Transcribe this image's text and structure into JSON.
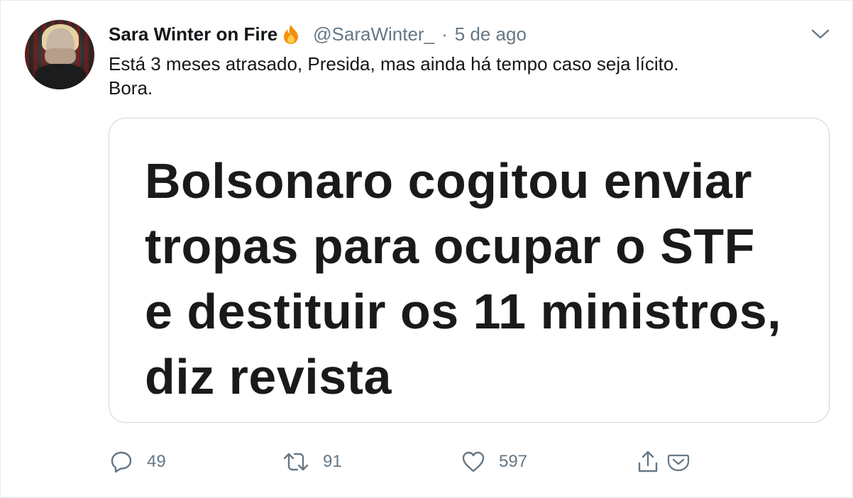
{
  "tweet": {
    "author_name": "Sara Winter on Fire",
    "author_emoji": "fire-icon",
    "handle": "@SaraWinter_",
    "separator": "·",
    "time": "5 de ago",
    "text_lines": [
      "Está 3 meses atrasado, Presida, mas ainda há tempo caso seja lícito.",
      "Bora."
    ]
  },
  "media": {
    "headline_lines": [
      "Bolsonaro cogitou enviar",
      "tropas para ocupar o STF",
      "e destituir os 11 ministros,",
      "diz revista"
    ]
  },
  "actions": {
    "replies": "49",
    "retweets": "91",
    "likes": "597"
  },
  "colors": {
    "text": "#14171a",
    "muted": "#657786",
    "border": "#ccd6dd",
    "fire": "#f4900c"
  }
}
